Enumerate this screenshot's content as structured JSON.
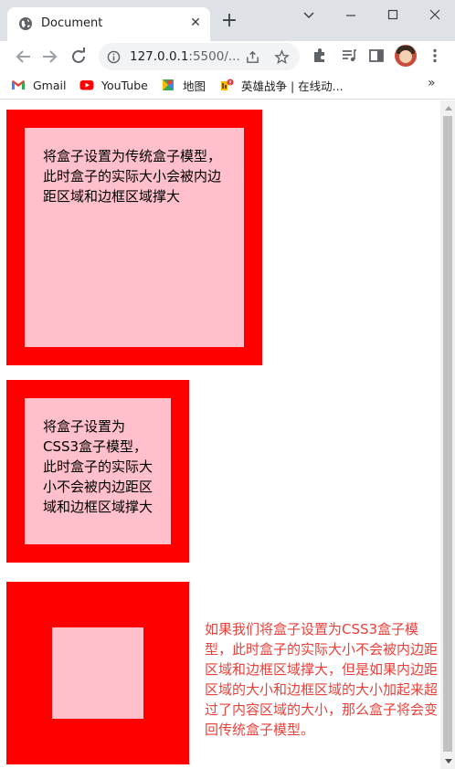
{
  "browser": {
    "tab_title": "Document",
    "url_host": "127.0.0.1",
    "url_rest": ":5500/...",
    "bookmarks": [
      {
        "label": "Gmail",
        "icon": "gmail-icon"
      },
      {
        "label": "YouTube",
        "icon": "youtube-icon"
      },
      {
        "label": "地图",
        "icon": "maps-icon"
      },
      {
        "label": "英雄战争 | 在线动...",
        "icon": "game-icon"
      }
    ],
    "more_bookmarks": "»"
  },
  "page": {
    "box1_text": "将盒子设置为传统盒子模型，此时盒子的实际大小会被内边距区域和边框区域撑大",
    "box2_text": "将盒子设置为CSS3盒子模型，此时盒子的实际大小不会被内边距区域和边框区域撑大",
    "note_text": "如果我们将盒子设置为CSS3盒子模型，此时盒子的实际大小不会被内边距区域和边框区域撑大，但是如果内边距区域的大小和边框区域的大小加起来超过了内容区域的大小，那么盒子将会变回传统盒子模型。"
  },
  "colors": {
    "border": "#ff0000",
    "content": "#ffc0cb",
    "note_text": "#e8413b",
    "titlebar": "#dee1e6"
  }
}
